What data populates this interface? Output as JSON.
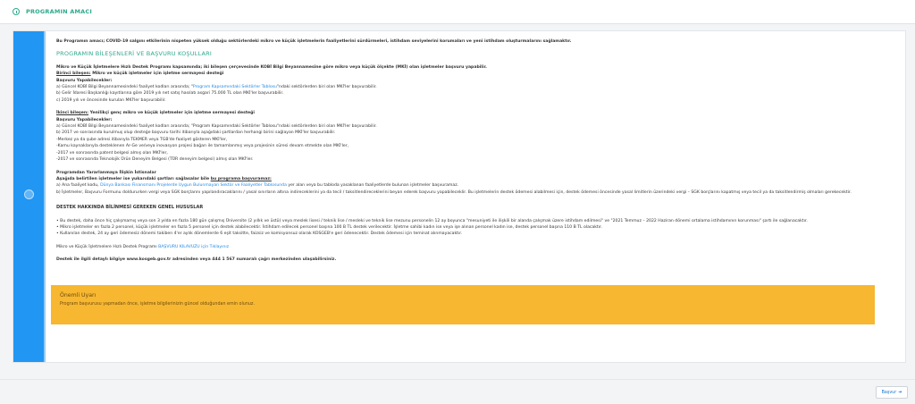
{
  "header": {
    "title": "PROGRAMIN AMACI"
  },
  "content": {
    "intro": "Bu Programın amacı; COVID-19 salgını etkilerinin nispeten yüksek olduğu sektörlerdeki mikro ve küçük işletmelerin faaliyetlerini sürdürmeleri, istihdam seviyelerini korumaları ve yeni istihdam oluşturmalarını sağlamaktır.",
    "section_title": "PROGRAMIN BİLEŞENLERİ VE BAŞVURU KOŞULLARI",
    "lead": "Mikro ve Küçük İşletmelere Hızlı Destek Programı kapsamında; iki bileşen çerçevesinde KOBİ Bilgi Beyannamesine göre mikro veya küçük ölçekte (MKİ) olan işletmeler başvuru yapabilir.",
    "comp1_label": "Birinci bileşen:",
    "comp1_title": " Mikro ve küçük işletmeler için işletme sermayesi desteği",
    "comp1_who": "Başvuru Yapabilecekler:",
    "comp1_a_pre": "a) Güncel KOBİ Bilgi Beyannamesindeki faaliyet kodları arasında; \"",
    "comp1_a_link": "Program Kapsamındaki Sektörler Tablosu",
    "comp1_a_post": "\"ndaki sektörlerden biri olan MKİ'ler başvurabilir.",
    "comp1_b": "b) Gelir İdaresi Başkanlığı kayıtlarına göre 2019 yılı net satış hasılatı asgari 75.000 TL olan MKİ'ler başvurabilir.",
    "comp1_c": "c) 2019 yılı ve öncesinde kurulan MKİ'ler başvurabilir.",
    "comp2_label": "İkinci bileşen:",
    "comp2_title": " Yenilikçi genç mikro ve küçük işletmeler için işletme sermayesi desteği",
    "comp2_who": "Başvuru Yapabilecekler:",
    "comp2_a": "a) Güncel KOBİ Bilgi Beyannamesindeki faaliyet kodları arasında; \"Program Kapsamındaki Sektörler Tablosu\"ndaki sektörlerden biri olan MKİ'ler başvurabilir.",
    "comp2_b": "b) 2017 ve sonrasında kurulmuş olup desteğe başvuru tarihi itibarıyla aşağıdaki şartlardan herhangi birini sağlayan MKİ'ler başvurabilir.",
    "comp2_list": [
      "-Merkez ya da şube adresi itibarıyla TEKMER veya TGB'de faaliyet gösteren MKİ'ler,",
      "-Kamu kaynaklarıyla desteklenen Ar-Ge ve/veya inovasyon projesi bağarı ile tamamlanmış veya projesinin süresi devam etmekte olan MKİ'ler,",
      "-2017 ve sonrasında patent belgesi almış olan MKİ'ler,",
      "-2017 ve sonrasında Teknolojik Ürün Deneyim Belgesi (TÜR deneyim belgesi) almış olan MKİ'ler."
    ],
    "excluded_title": "Programdan Yararlanmaya İlişkin İstisnalar",
    "excluded_lead_pre": "Aşağıda belirtilen işletmeler ise yukarıdaki şartları sağlasalar bile ",
    "excluded_lead_u": "bu programa başvuramaz:",
    "excluded_a_pre": "a) Ana faaliyet kodu, ",
    "excluded_a_link": "Dünya Bankası Finansmanı Projelerde Uygun Bulunmayan Sektör ve Faaliyetler Tablosunda",
    "excluded_a_post": " yer alan veya bu tabloda yasaklanan faaliyetlerde bulunan işletmeler başvuramaz.",
    "excluded_b": "b) İşletmeler, Başvuru Formunu doldururken vergi veya SGK borçlarını yapılandıracaklarını / yasal sınırların altına indireceklerini ya da tecil / taksitlendireceklerini beyan ederek başvuru yapabileceklir. Bu işletmelerin destek ödemesi alabilmesi için, destek ödemesi öncesinde yasal limitlerin üzerindeki vergi – SGK borçlarını kapatmış veya tecil ya da taksitlendirmiş olmaları gerekecektir.",
    "general_title": "DESTEK HAKKINDA BİLİNMESİ GEREKEN GENEL HUSUSLAR",
    "general_list": [
      "• Bu destek, daha önce hiç çalışmamış veya son 3 yılda en fazla 180 gün çalışmış Üniversite (2 yıllık ve üstü) veya meslek lisesi / teknik lise / mesleki ve teknik lise mezunu personelin 12 ay boyunca \"mesuniyeti ile ilişkili bir alanda çalışmak üzere istihdam edilmesi\" ve \"2021 Temmuz – 2022 Haziran dönemi ortalama istihdamının korunması\" şartı ile sağlanacaktır.",
      "• Mikro işletmeler en fazla 2 personel, küçük işletmeler en fazla 5 personel için destek alabilecektir. İstihdam edilecek personel başına 100 B TL destek verilecektir. İşletme sahibi kadın ise veya işe alınan personel kadın ise, destek personel başına 110 B TL olacaktır.",
      "• Kullanılan destek, 24 ay geri ödemesiz dönemi takiben 4'er aylık dönemlerde 6 eşit taksitte, faizsiz ve komisyonsuz olarak KOSGEB'e geri ödenecektir. Destek ödemesi için teminat alınmayacaktır."
    ],
    "guide_pre": "Mikro ve Küçük İşletmelere Hızlı Destek Programı ",
    "guide_link": "BAŞVURU KILAVUZU için Tıklayınız",
    "contact": "Destek ile ilgili detaylı bilgiye www.kosgeb.gov.tr adresinden veya 444 1 567 numaralı çağrı merkezinden ulaşabilirsiniz."
  },
  "note": {
    "title": "Önemli Uyarı",
    "text": "Program başvurusu yapmadan önce, işletme bilgilerinizin güncel olduğundan emin olunuz."
  },
  "footer": {
    "back_label": "Başvur"
  },
  "colors": {
    "accent": "#2196f3",
    "section": "#2fa98c",
    "warning": "#f7b731"
  }
}
